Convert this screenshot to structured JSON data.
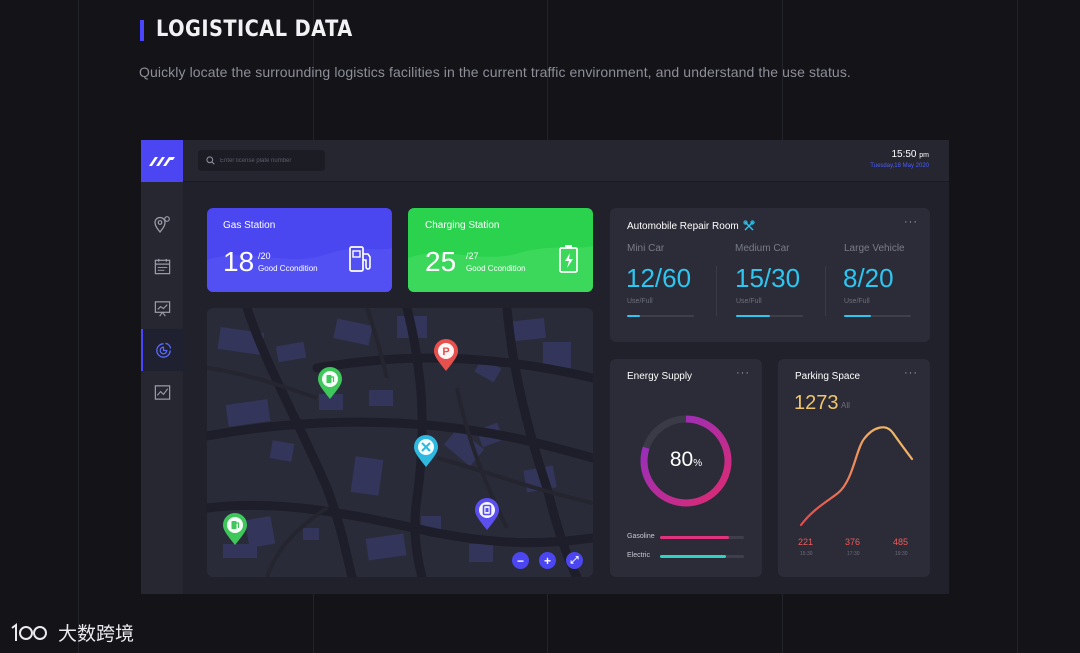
{
  "header": {
    "title": "LOGISTICAL DATA",
    "subtitle": "Quickly locate the surrounding logistics facilities in the current traffic environment, and understand the use status."
  },
  "topbar": {
    "search_placeholder": "Enter license plate number",
    "time": "15:50",
    "time_suffix": "pm",
    "date": "Tuesday,18 May 2020"
  },
  "sidebar": {
    "items": [
      {
        "icon": "map-pin-icon"
      },
      {
        "icon": "calendar-icon"
      },
      {
        "icon": "chart-board-icon"
      },
      {
        "icon": "pie-chart-icon",
        "active": true
      },
      {
        "icon": "trend-icon"
      }
    ]
  },
  "gas_station": {
    "title": "Gas Station",
    "value": "18",
    "total": "/20",
    "status": "Good Ccondition",
    "color": "#4a46f0"
  },
  "charging_station": {
    "title": "Charging Station",
    "value": "25",
    "total": "/27",
    "status": "Good Ccondition",
    "color": "#2bd24e"
  },
  "repair": {
    "title": "Automobile Repair Room",
    "more": "···",
    "items": [
      {
        "label": "Mini Car",
        "value": "12/60",
        "caption": "Use/Full",
        "fraction": 0.2
      },
      {
        "label": "Medium Car",
        "value": "15/30",
        "caption": "Use/Full",
        "fraction": 0.5
      },
      {
        "label": "Large Vehicle",
        "value": "8/20",
        "caption": "Use/Full",
        "fraction": 0.4
      }
    ]
  },
  "energy": {
    "title": "Energy Supply",
    "more": "···",
    "percent": "80",
    "percent_sign": "%",
    "legend": [
      {
        "label": "Gasoline",
        "fraction": 0.82,
        "color": "#e0337d"
      },
      {
        "label": "Electric",
        "fraction": 0.78,
        "color": "#2fd3c4"
      }
    ]
  },
  "parking": {
    "title": "Parking Space",
    "more": "···",
    "value": "1273",
    "unit": "All",
    "points": [
      {
        "value": "221",
        "time": "15:30"
      },
      {
        "value": "376",
        "time": "17:30"
      },
      {
        "value": "485",
        "time": "19:30"
      }
    ]
  },
  "map": {
    "pins": [
      {
        "type": "gas",
        "color": "#3fc75c",
        "glyph": "gas-pump-icon"
      },
      {
        "type": "parking",
        "color": "#e8504e",
        "glyph": "P"
      },
      {
        "type": "repair",
        "color": "#2fb8e0",
        "glyph": "wrench-icon"
      },
      {
        "type": "charging",
        "color": "#5b4ff0",
        "glyph": "battery-icon"
      },
      {
        "type": "gas",
        "color": "#3fc75c",
        "glyph": "gas-pump-icon"
      }
    ],
    "controls": {
      "zoom_out": "−",
      "zoom_in": "+",
      "fullscreen": "⤢"
    }
  },
  "brand": {
    "logo_text": "100",
    "name": "大数跨境"
  },
  "colors": {
    "accent": "#4b46f1",
    "teal": "#2ec5f0",
    "gold": "#f1c470"
  }
}
